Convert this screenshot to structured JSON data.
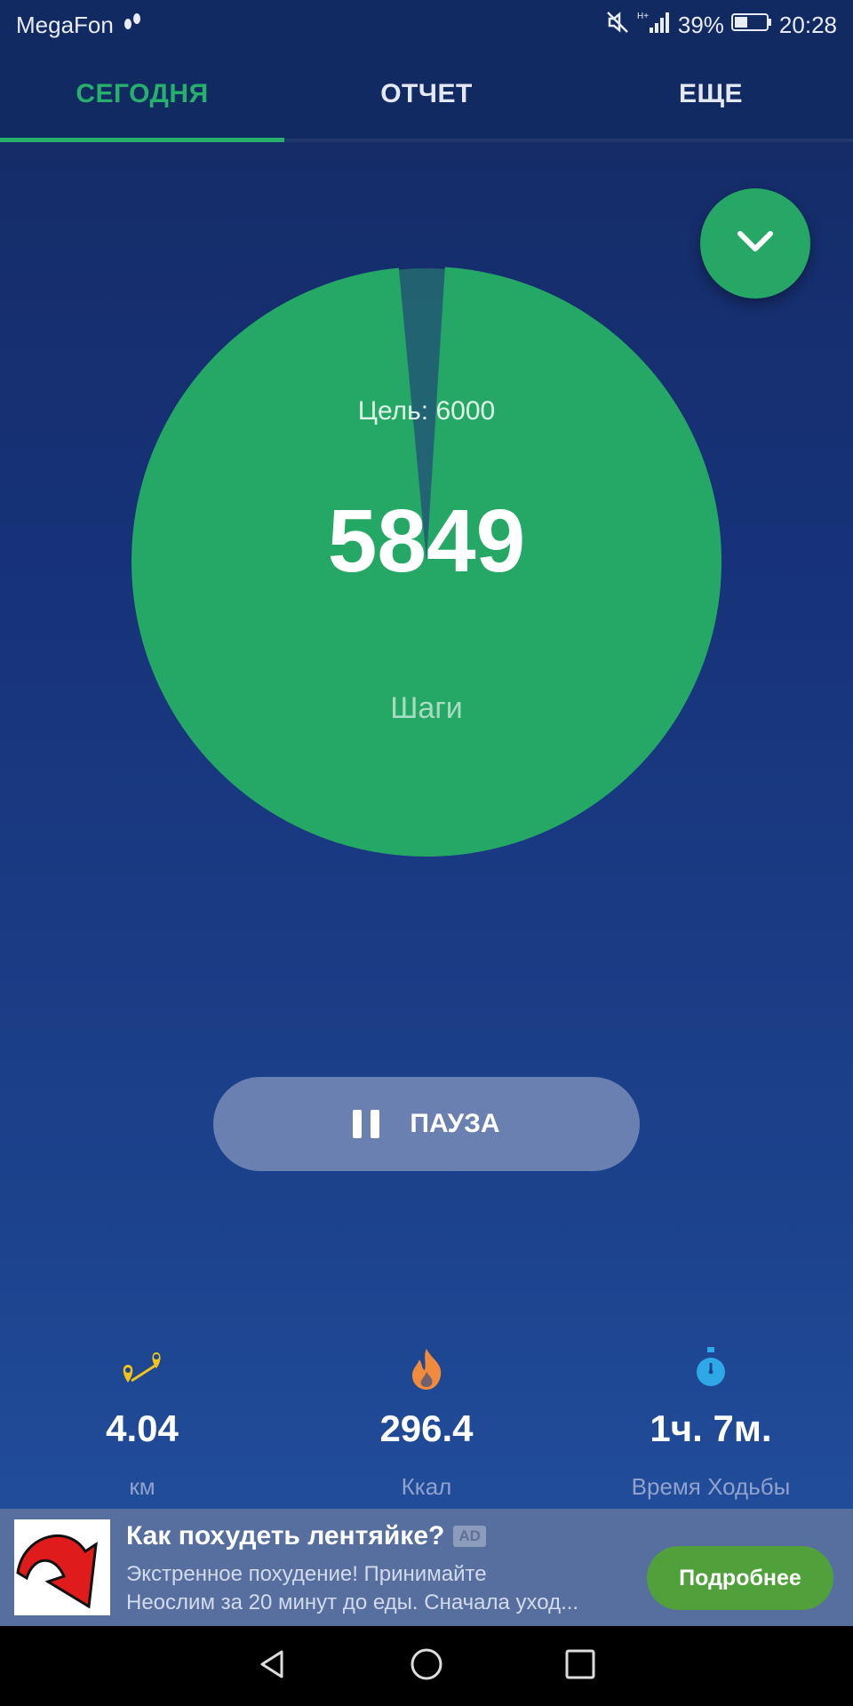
{
  "status_bar": {
    "carrier": "MegaFon",
    "battery": "39%",
    "time": "20:28",
    "network": "H+"
  },
  "tabs": [
    {
      "label": "СЕГОДНЯ",
      "active": true
    },
    {
      "label": "ОТЧЕТ",
      "active": false
    },
    {
      "label": "ЕЩЕ",
      "active": false
    }
  ],
  "progress": {
    "goal_text": "Цель: 6000",
    "steps": "5849",
    "steps_label": "Шаги",
    "goal_value": 6000,
    "steps_value": 5849,
    "fraction": 0.975
  },
  "pause_button": {
    "label": "ПАУЗА"
  },
  "stats": [
    {
      "icon": "map-pin-route-icon",
      "value": "4.04",
      "label": "км"
    },
    {
      "icon": "flame-icon",
      "value": "296.4",
      "label": "Ккал"
    },
    {
      "icon": "stopwatch-icon",
      "value": "1ч. 7м.",
      "label": "Время Ходьбы"
    }
  ],
  "ad": {
    "title": "Как похудеть лентяйке?",
    "badge": "AD",
    "description_line1": "Экстренное похудение! Принимайте",
    "description_line2": "Неослим за 20 минут до еды. Сначала уход...",
    "cta": "Подробнее"
  },
  "colors": {
    "accent_green": "#27b06b",
    "circle_green": "#25a865",
    "background_top": "#142a63",
    "pause_button": "#6a80b0",
    "ad_cta": "#50a13c"
  }
}
